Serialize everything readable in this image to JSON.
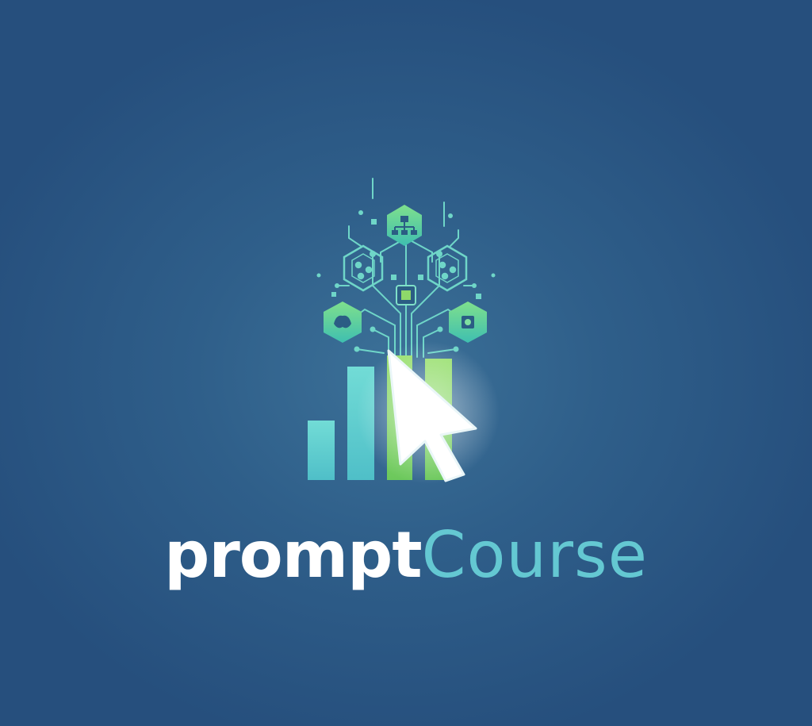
{
  "brand": {
    "wordmark_part1": "prompt",
    "wordmark_part2": "Course",
    "name": "promptCourse"
  },
  "colors": {
    "background": "#2a5682",
    "wordmark_primary": "#ffffff",
    "wordmark_accent": "#64c8d2",
    "teal": "#5fd0cf",
    "green": "#8ed86a",
    "cursor": "#ffffff"
  },
  "icons": [
    "hexagon-network-icon",
    "hexagon-chip-icon",
    "hexagon-brain-icon",
    "hexagon-gear-icon",
    "circuit-tree-icon",
    "bar-chart-icon",
    "cursor-arrow-icon"
  ]
}
